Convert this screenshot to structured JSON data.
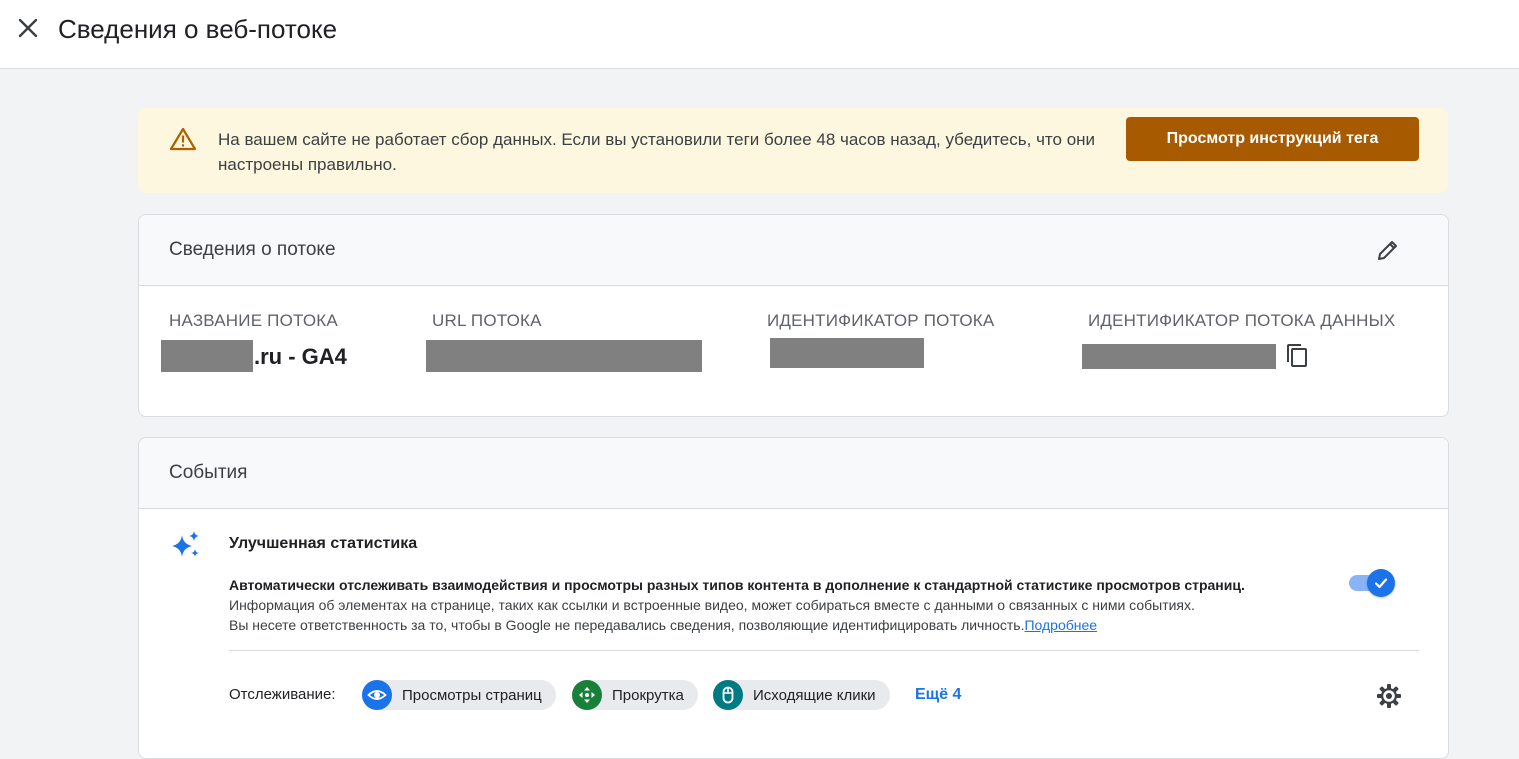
{
  "header": {
    "title": "Сведения о веб-потоке"
  },
  "alert": {
    "text": "На вашем сайте не работает сбор данных. Если вы установили теги более 48 часов назад, убедитесь, что они настроены правильно.",
    "button_label": "Просмотр инструкций тега",
    "button_color": "#a85a00",
    "background": "#fef7e0"
  },
  "stream_details": {
    "title": "Сведения о потоке",
    "stream_name_label": "НАЗВАНИЕ ПОТОКА",
    "stream_name_suffix": ".ru - GA4",
    "stream_url_label": "URL ПОТОКА",
    "stream_id_label": "ИДЕНТИФИКАТОР ПОТОКА",
    "data_stream_id_label": "ИДЕНТИФИКАТОР ПОТОКА ДАННЫХ"
  },
  "events": {
    "title": "События",
    "enhanced_title": "Улучшенная статистика",
    "enhanced_desc_bold": "Автоматически отслеживать взаимодействия и просмотры разных типов контента в дополнение к стандартной статистике просмотров страниц.",
    "enhanced_desc_line2": "Информация об элементах на странице, таких как ссылки и встроенные видео, может собираться вместе с данными о связанных с ними событиях.",
    "enhanced_desc_line3": "Вы несете ответственность за то, чтобы в Google не передавались сведения, позволяющие идентифицировать личность.",
    "learn_more": "Подробнее",
    "toggle_on": true,
    "tracking_label": "Отслеживание:",
    "chips": [
      {
        "label": "Просмотры страниц",
        "icon": "eye-icon",
        "color": "#1a73e8"
      },
      {
        "label": "Прокрутка",
        "icon": "scroll-arrows-icon",
        "color": "#188038"
      },
      {
        "label": "Исходящие клики",
        "icon": "mouse-icon",
        "color": "#007b83"
      }
    ],
    "more_label": "Ещё 4"
  }
}
